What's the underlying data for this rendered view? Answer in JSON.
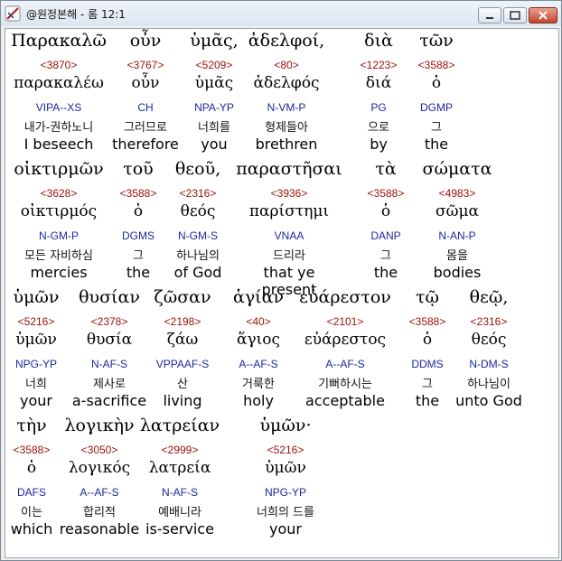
{
  "window": {
    "title": "@원정본해 - 롬 12:1",
    "icon": "app-quill-icon",
    "buttons": [
      "minimize",
      "maximize",
      "close"
    ]
  },
  "verses": [
    [
      {
        "greek": "Παρακαλῶ",
        "strong": "<3870>",
        "lemma": "παρακαλέω",
        "parse": "VIPA--XS",
        "korean": "내가-권하노니",
        "english": "I beseech"
      },
      {
        "greek": "οὖν",
        "strong": "<3767>",
        "lemma": "οὖν",
        "parse": "CH",
        "korean": "그러므로",
        "english": "therefore"
      },
      {
        "greek": "ὑμᾶς,",
        "strong": "<5209>",
        "lemma": "ὑμᾶς",
        "parse": "NPA-YP",
        "korean": "너희를",
        "english": "you"
      },
      {
        "greek": "ἀδελφοί,",
        "strong": "<80>",
        "lemma": "ἀδελφός",
        "parse": "N-VM-P",
        "korean": "형제들아",
        "english": "brethren"
      },
      {
        "greek": "διὰ",
        "strong": "<1223>",
        "lemma": "διά",
        "parse": "PG",
        "korean": "으로",
        "english": "by"
      },
      {
        "greek": "τῶν",
        "strong": "<3588>",
        "lemma": "ὁ",
        "parse": "DGMP",
        "korean": "그",
        "english": "the"
      }
    ],
    [
      {
        "greek": "οἰκτιρμῶν",
        "strong": "<3628>",
        "lemma": "οἰκτιρμός",
        "parse": "N-GM-P",
        "korean": "모든 자비하심",
        "english": "mercies"
      },
      {
        "greek": "τοῦ",
        "strong": "<3588>",
        "lemma": "ὁ",
        "parse": "DGMS",
        "korean": "그",
        "english": "the"
      },
      {
        "greek": "θεοῦ,",
        "strong": "<2316>",
        "lemma": "θεός",
        "parse": "N-GM-S",
        "korean": "하나님의",
        "english": "of God"
      },
      {
        "greek": "παραστῆσαι",
        "strong": "<3936>",
        "lemma": "παρίστημι",
        "parse": "VNAA",
        "korean": "드리라",
        "english": "that ye present"
      },
      {
        "greek": "τὰ",
        "strong": "<3588>",
        "lemma": "ὁ",
        "parse": "DANP",
        "korean": "그",
        "english": "the"
      },
      {
        "greek": "σώματα",
        "strong": "<4983>",
        "lemma": "σῶμα",
        "parse": "N-AN-P",
        "korean": "몸을",
        "english": "bodies"
      }
    ],
    [
      {
        "greek": "ὑμῶν",
        "strong": "<5216>",
        "lemma": "ὑμῶν",
        "parse": "NPG-YP",
        "korean": "너희",
        "english": "your"
      },
      {
        "greek": "θυσίαν",
        "strong": "<2378>",
        "lemma": "θυσία",
        "parse": "N-AF-S",
        "korean": "제사로",
        "english": "a-sacrifice"
      },
      {
        "greek": "ζῶσαν",
        "strong": "<2198>",
        "lemma": "ζάω",
        "parse": "VPPAAF-S",
        "korean": "산",
        "english": "living"
      },
      {
        "greek": "ἁγίαν",
        "strong": "<40>",
        "lemma": "ἅγιος",
        "parse": "A--AF-S",
        "korean": "거룩한",
        "english": "holy"
      },
      {
        "greek": "εὐάρεστον",
        "strong": "<2101>",
        "lemma": "εὐάρεστος",
        "parse": "A--AF-S",
        "korean": "기뻐하시는",
        "english": "acceptable"
      },
      {
        "greek": "τῷ",
        "strong": "<3588>",
        "lemma": "ὁ",
        "parse": "DDMS",
        "korean": "그",
        "english": "the"
      },
      {
        "greek": "θεῷ,",
        "strong": "<2316>",
        "lemma": "θεός",
        "parse": "N-DM-S",
        "korean": "하나님이",
        "english": "unto God"
      }
    ],
    [
      {
        "greek": "τὴν",
        "strong": "<3588>",
        "lemma": "ὁ",
        "parse": "DAFS",
        "korean": "이는",
        "english": "which"
      },
      {
        "greek": "λογικὴν",
        "strong": "<3050>",
        "lemma": "λογικός",
        "parse": "A--AF-S",
        "korean": "합리적",
        "english": "reasonable"
      },
      {
        "greek": "λατρείαν",
        "strong": "<2999>",
        "lemma": "λατρεία",
        "parse": "N-AF-S",
        "korean": "예배니라",
        "english": "is-service"
      },
      {
        "greek": "ὑμῶν·",
        "strong": "<5216>",
        "lemma": "ὑμῶν",
        "parse": "NPG-YP",
        "korean": "너희의 드를",
        "english": "your"
      }
    ]
  ]
}
